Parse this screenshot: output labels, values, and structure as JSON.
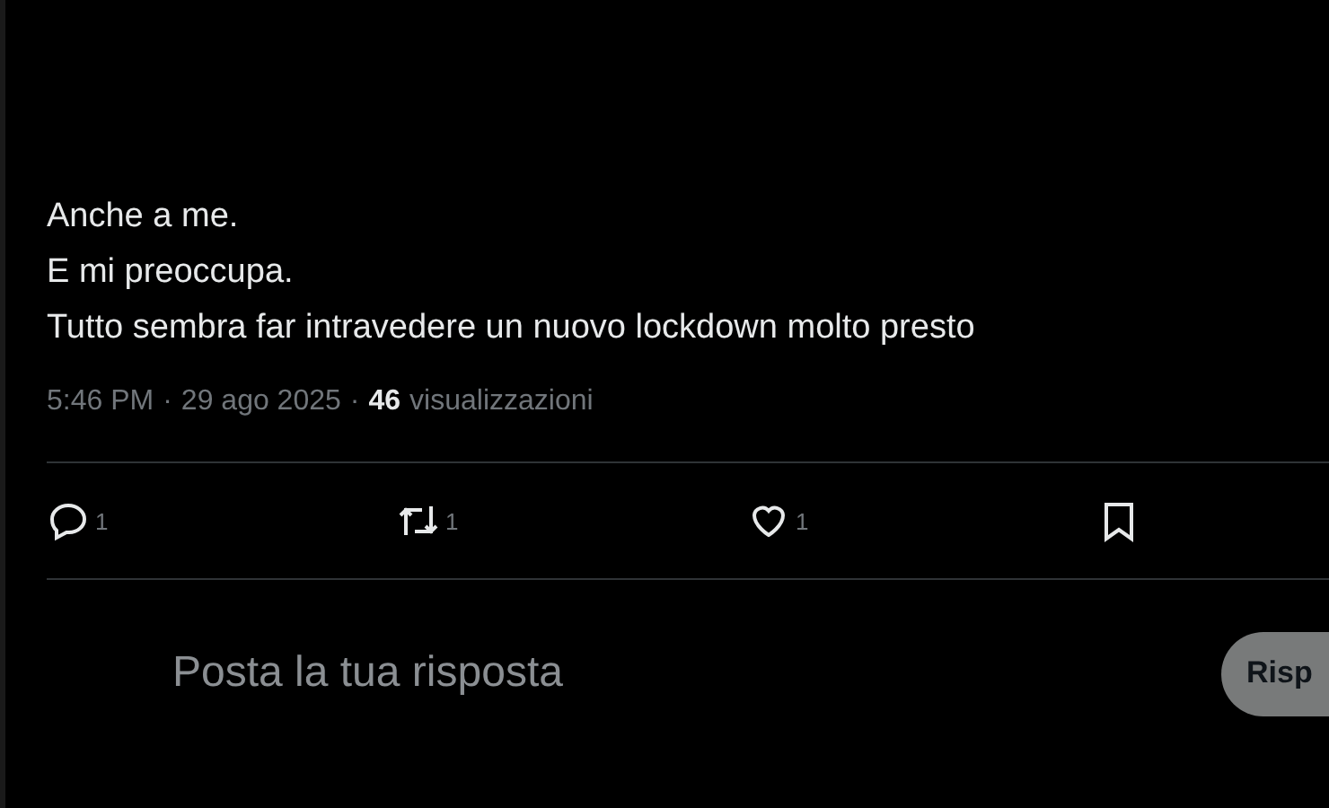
{
  "post": {
    "lines": [
      "Anche a me.",
      "E mi preoccupa.",
      "Tutto sembra far intravedere un nuovo lockdown molto presto"
    ],
    "time": "5:46 PM",
    "separator": "·",
    "date": "29 ago 2025",
    "views_count": "46",
    "views_label": "visualizzazioni"
  },
  "actions": [
    {
      "kind": "reply",
      "count": "1"
    },
    {
      "kind": "repost",
      "count": "1"
    },
    {
      "kind": "like",
      "count": "1"
    },
    {
      "kind": "bookmark"
    }
  ],
  "composer": {
    "placeholder": "Posta la tua risposta",
    "button": "Risp"
  }
}
